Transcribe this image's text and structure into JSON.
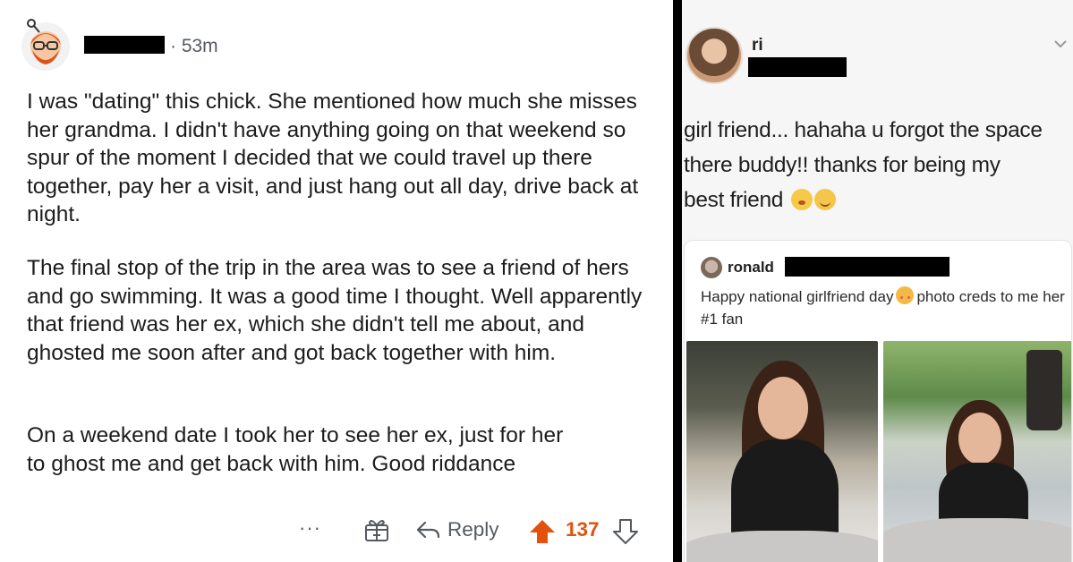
{
  "comment": {
    "time": "· 53m",
    "paragraphs": [
      "I was \"dating\" this chick. She mentioned how much she misses her grandma. I didn't have anything going on that weekend so spur of the moment I decided that we could travel up there together, pay her a visit, and just hang out all day, drive back at night.",
      "The final stop of the trip in the area was to see a friend of hers and go swimming. It was a good time I thought. Well apparently that friend was her ex, which she didn't tell me about, and ghosted me soon after and got back together with him.",
      "On a weekend date I took her to see her ex, just for her to ghost me and get back with him. Good riddance"
    ],
    "actions": {
      "more": "···",
      "award_icon": "gift-icon",
      "reply_icon": "reply-arrow-icon",
      "reply": "Reply",
      "upvote_icon": "upvote-arrow-icon",
      "score": "137",
      "downvote_icon": "downvote-arrow-icon"
    },
    "accent_color": "#e4510d"
  },
  "tweet": {
    "author_name": "ri",
    "text_line1": "girl friend... hahaha u forgot the space",
    "text_line2": "there buddy!! thanks for being my",
    "text_line3": "best friend",
    "emojis": [
      "hushed-face-icon",
      "relieved-face-icon"
    ],
    "quoted": {
      "author_name": "ronald",
      "text_before": "Happy national girlfriend day",
      "text_after": "photo creds to me her #1 fan",
      "emoji": "smiling-face-with-hearts-icon"
    }
  }
}
